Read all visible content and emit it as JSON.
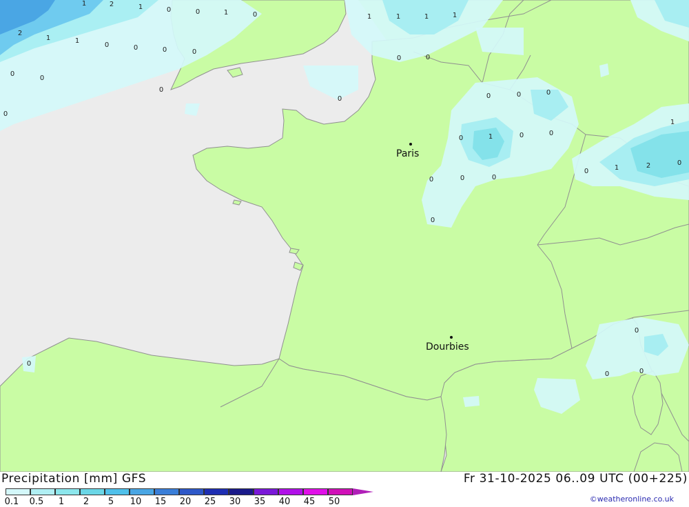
{
  "header": {
    "title": "Precipitation [mm] GFS",
    "timestamp": "Fr 31-10-2025 06..09 UTC (00+225)"
  },
  "colors": {
    "land": "#c9fca4",
    "sea": "#ececec",
    "border": "#909090",
    "precip_light": "#d4f8fa",
    "precip_mid": "#a8eef2",
    "precip_strong": "#84e2ea",
    "precip_blue1": "#6cc8ee",
    "precip_blue2": "#4aa6e4"
  },
  "cities": [
    {
      "name": "Paris"
    },
    {
      "name": "Dourbies"
    }
  ],
  "values": [
    "1",
    "2",
    "1",
    "0",
    "0",
    "1",
    "0",
    "2",
    "1",
    "1",
    "0",
    "0",
    "0",
    "0",
    "0",
    "0",
    "0",
    "0",
    "1",
    "1",
    "1",
    "1",
    "0",
    "0",
    "0",
    "0",
    "0",
    "0",
    "0",
    "1",
    "0",
    "0",
    "0",
    "0",
    "0",
    "1",
    "1",
    "2",
    "0",
    "0",
    "0",
    "0",
    "0",
    "0",
    "0"
  ],
  "legend": {
    "ticks": [
      "0.1",
      "0.5",
      "1",
      "2",
      "5",
      "10",
      "15",
      "20",
      "25",
      "30",
      "35",
      "40",
      "45",
      "50"
    ],
    "colors": [
      "#d4f8fa",
      "#b0eff3",
      "#8ce6ec",
      "#6ad6e6",
      "#50c0ea",
      "#4aa6e4",
      "#3a7ed8",
      "#2e58c8",
      "#1e2eb2",
      "#1a1a8a",
      "#7a18d8",
      "#b010e8",
      "#e010e8",
      "#d010b8"
    ],
    "arrow_color": "#b020b8"
  },
  "credit": "©weatheronline.co.uk"
}
